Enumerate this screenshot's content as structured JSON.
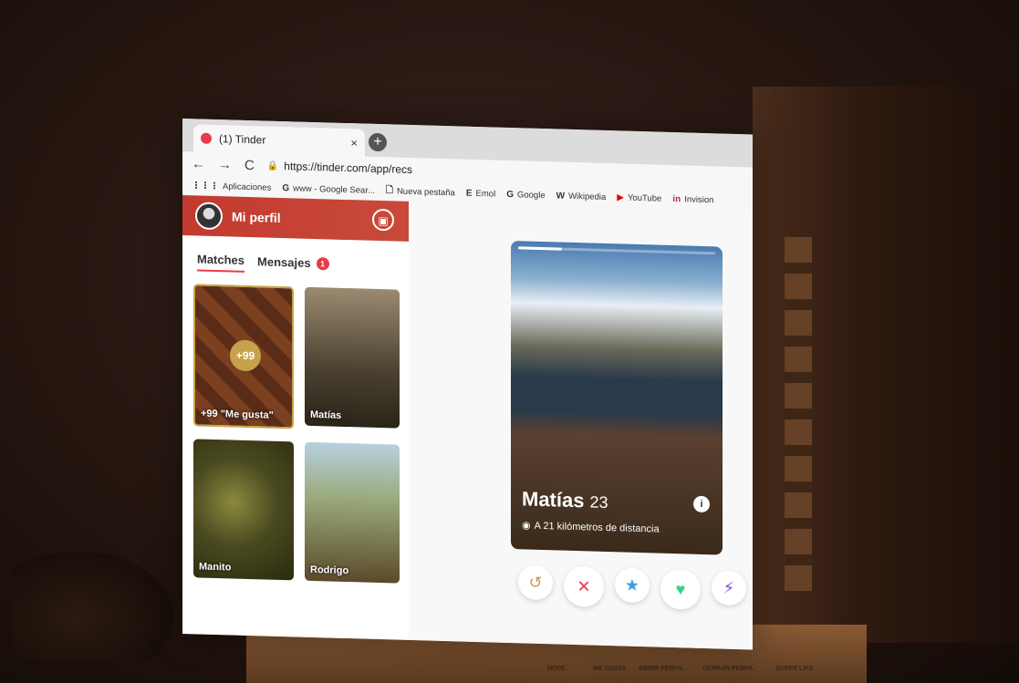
{
  "browser": {
    "tab_title": "(1) Tinder",
    "tab_close": "×",
    "new_tab": "+",
    "back": "←",
    "forward": "→",
    "reload": "C",
    "url": "https://tinder.com/app/recs",
    "bookmarks": [
      {
        "icon": "⋮⋮⋮",
        "label": "Aplicaciones"
      },
      {
        "icon": "G",
        "label": "www - Google Sear..."
      },
      {
        "icon": "🗋",
        "label": "Nueva pestaña"
      },
      {
        "icon": "E",
        "label": "Emol"
      },
      {
        "icon": "G",
        "label": "Google"
      },
      {
        "icon": "W",
        "label": "Wikipedia"
      },
      {
        "icon": "▶",
        "label": "YouTube"
      },
      {
        "icon": "in",
        "label": "Invision"
      }
    ]
  },
  "sidebar": {
    "profile_label": "Mi perfil",
    "tabs": [
      {
        "label": "Matches"
      },
      {
        "label": "Mensajes",
        "badge": "1"
      }
    ],
    "cards": [
      {
        "name": "+99 \"Me gusta\"",
        "count": "+99"
      },
      {
        "name": "Matías"
      },
      {
        "name": "Manito"
      },
      {
        "name": "Rodrigo"
      }
    ]
  },
  "profile_card": {
    "name": "Matías",
    "age": "23",
    "distance": "A 21 kilómetros de distancia",
    "info": "i"
  },
  "actions": [
    {
      "icon": "rewind-icon",
      "glyph": "↺",
      "color": "#c8a24a"
    },
    {
      "icon": "nope-icon",
      "glyph": "✕",
      "color": "#e83c4a"
    },
    {
      "icon": "superlike-icon",
      "glyph": "★",
      "color": "#3aa0e0"
    },
    {
      "icon": "like-icon",
      "glyph": "♥",
      "color": "#3ad08a"
    },
    {
      "icon": "boost-icon",
      "glyph": "⚡",
      "color": "#8a4ae0"
    }
  ],
  "shelf_labels": [
    "NOPE",
    "ME GUSTA",
    "ABRIR PERFIL",
    "CERRAR PERFIL",
    "SUPER LIKE"
  ]
}
